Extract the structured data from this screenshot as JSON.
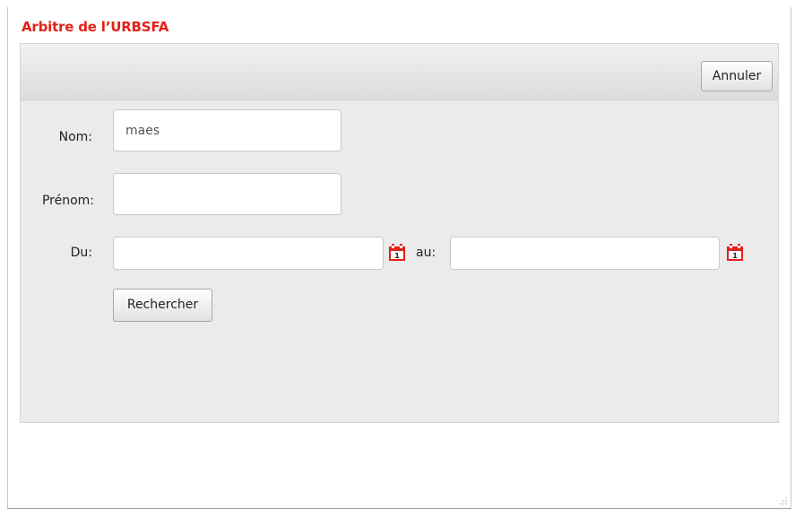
{
  "dialog": {
    "title": "Arbitre de l’URBSFA"
  },
  "toolbar": {
    "cancel_label": "Annuler"
  },
  "form": {
    "nom_label": "Nom:",
    "nom_value": "maes",
    "prenom_label": "Prénom:",
    "prenom_value": "",
    "du_label": "Du:",
    "du_value": "",
    "au_label": "au:",
    "au_value": "",
    "search_label": "Rechercher",
    "calendar_day": "1"
  },
  "icons": {
    "calendar": "calendar-icon",
    "resize": "resize-grip-icon"
  },
  "colors": {
    "title": "#e32119",
    "calendar_icon": "#e32119",
    "panel_background": "#ebebeb"
  }
}
